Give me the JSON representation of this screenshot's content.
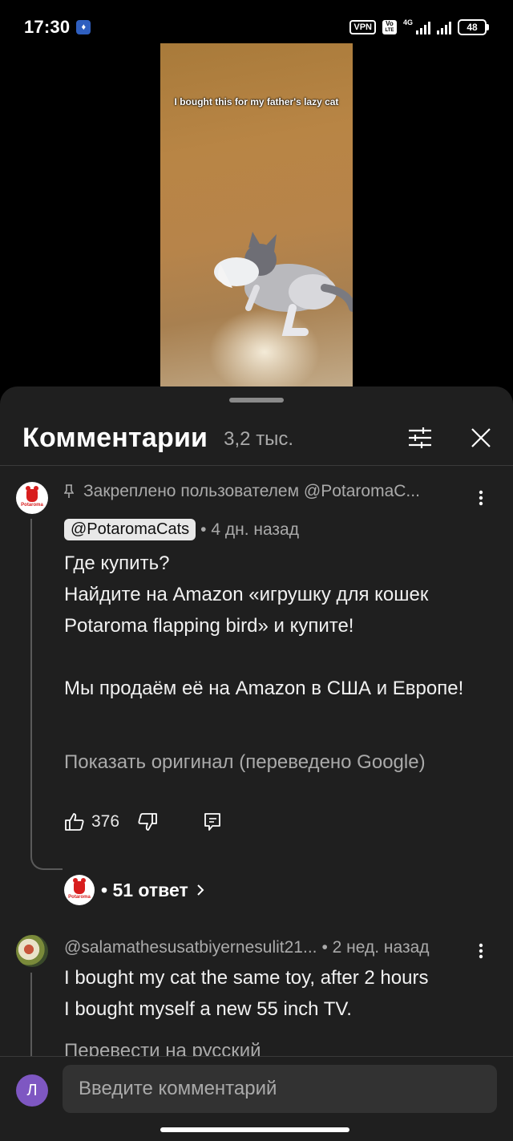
{
  "status_bar": {
    "time": "17:30",
    "vpn": "VPN",
    "volte_top": "Vo",
    "volte_bottom": "LTE",
    "network": "4G",
    "battery": "48"
  },
  "video": {
    "caption": "I bought this for my father's lazy cat"
  },
  "comments_panel": {
    "title": "Комментарии",
    "count": "3,2 тыс.",
    "icons": {
      "filter": "sliders-icon",
      "close": "close-icon"
    }
  },
  "comments": [
    {
      "pinned_label": "Закреплено пользователем @PotaromaC...",
      "author": "@PotaromaCats",
      "time": "• 4 дн. назад",
      "text": "Где купить?\nНайдите на Amazon «игрушку для кошек Potaroma flapping bird» и купите!\n\nМы продаём её на Amazon в США и Европе!",
      "translate_link": "Показать оригинал (переведено Google)",
      "likes": "376",
      "replies_label": "• 51 ответ",
      "avatar_brand": "Potaroma"
    },
    {
      "author": "@salamathesusatbiyernesulit21...",
      "time": "• 2 нед. назад",
      "text": "I bought my cat the same toy, after 2 hours\nI bought myself a new 55 inch TV.",
      "translate_link": "Перевести на русский"
    }
  ],
  "composer": {
    "avatar_letter": "Л",
    "placeholder": "Введите комментарий"
  }
}
